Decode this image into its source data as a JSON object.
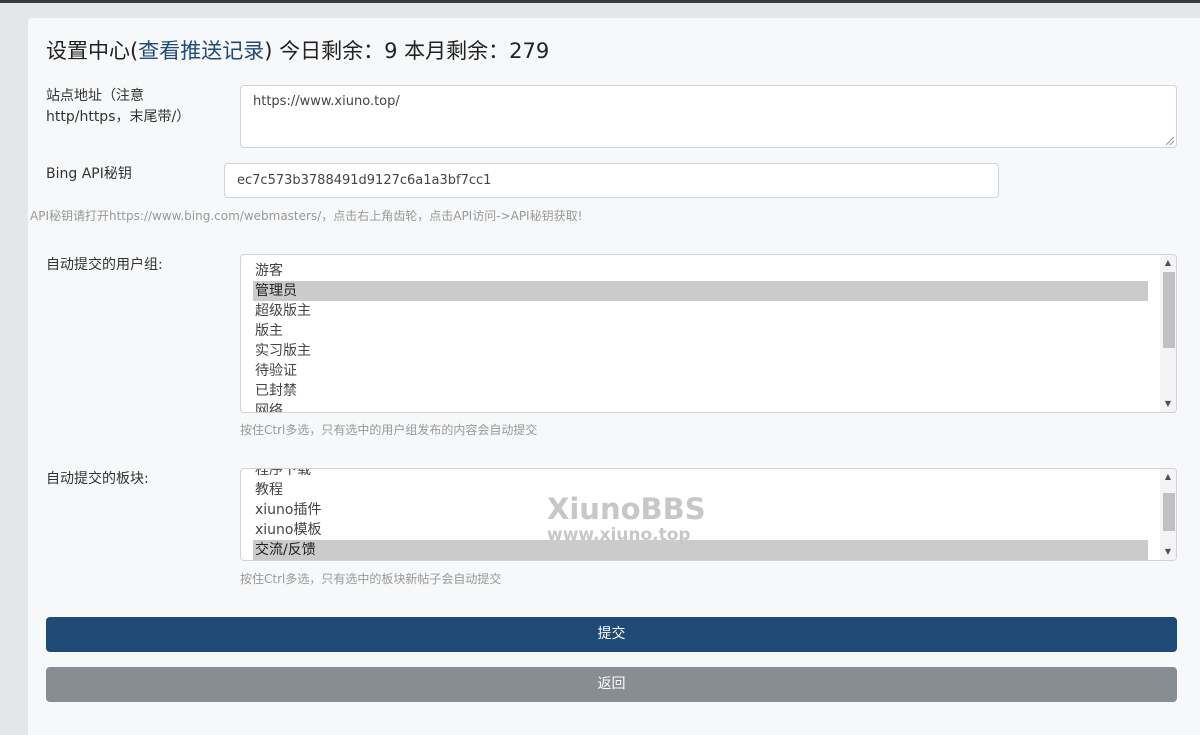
{
  "header": {
    "title_prefix": "设置中心(",
    "title_link": "查看推送记录",
    "title_suffix": ") 今日剩余：9 本月剩余：279"
  },
  "site_url": {
    "label": "站点地址（注意http/https，末尾带/）",
    "value": "https://www.xiuno.top/"
  },
  "bing_api": {
    "label": "Bing API秘钥",
    "value": "ec7c573b3788491d9127c6a1a3bf7cc1",
    "help": "API秘钥请打开https://www.bing.com/webmasters/，点击右上角齿轮，点击API访问->API秘钥获取!"
  },
  "user_groups": {
    "label": "自动提交的用户组:",
    "options": [
      {
        "text": "游客",
        "selected": false
      },
      {
        "text": "管理员",
        "selected": true
      },
      {
        "text": "超级版主",
        "selected": false
      },
      {
        "text": "版主",
        "selected": false
      },
      {
        "text": "实习版主",
        "selected": false
      },
      {
        "text": "待验证",
        "selected": false
      },
      {
        "text": "已封禁",
        "selected": false
      },
      {
        "text": "网络",
        "selected": false
      }
    ],
    "help": "按住Ctrl多选，只有选中的用户组发布的内容会自动提交"
  },
  "forums": {
    "label": "自动提交的板块:",
    "options": [
      {
        "text": "程序下载",
        "selected": false
      },
      {
        "text": "教程",
        "selected": false
      },
      {
        "text": "xiuno插件",
        "selected": false
      },
      {
        "text": "xiuno模板",
        "selected": false
      },
      {
        "text": "交流/反馈",
        "selected": true
      }
    ],
    "help": "按住Ctrl多选，只有选中的板块新帖子会自动提交"
  },
  "buttons": {
    "submit": "提交",
    "back": "返回"
  },
  "watermark": {
    "main": "XiunoBBS",
    "sub": "www.xiuno.top"
  },
  "colors": {
    "primary": "#1f4a75",
    "secondary": "#878d93",
    "link": "#1f4a7a"
  }
}
